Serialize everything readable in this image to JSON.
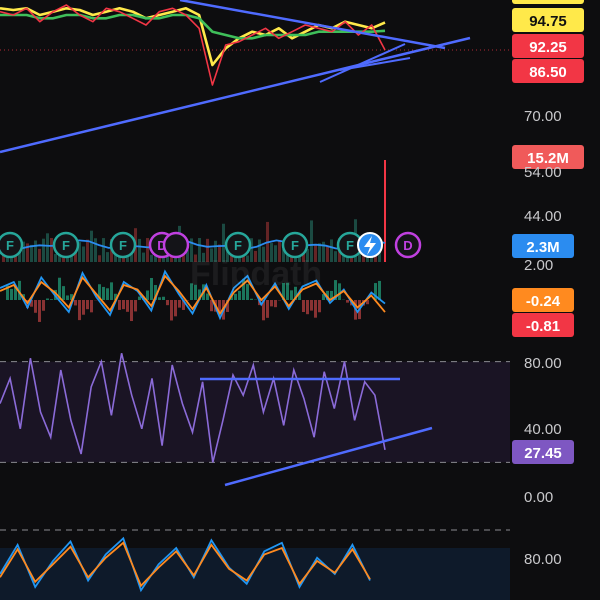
{
  "watermark": "Flipdath",
  "colors": {
    "background": "#0d0d0f",
    "rsi_band": "#1a1424",
    "yellow": "#ffe94a",
    "red": "#f23645",
    "blue_line": "#4f6bff",
    "volume_badge": "#f05a5a",
    "blue_badge": "#2b8cf0",
    "orange_badge": "#ff8a1f",
    "purple_badge": "#7e57c2",
    "macd_blue": "#2196f3",
    "macd_orange": "#ff8a1f",
    "rsi_purple": "#8b6bd8",
    "stoch_fill": "#0e1a2a",
    "event_green": "#26a69a",
    "event_purple": "#c040e0"
  },
  "price_axis": {
    "badges": [
      {
        "label": "94.75",
        "kind": "yellow"
      },
      {
        "label": "92.25",
        "kind": "red"
      },
      {
        "label": "86.50",
        "kind": "red"
      }
    ],
    "ticks": [
      "70.00"
    ]
  },
  "volume_axis": {
    "badge": "15.2M",
    "ticks": [
      "54.00",
      "44.00"
    ]
  },
  "event_markers": {
    "labels": [
      "F",
      "F",
      "F",
      "D",
      "F",
      "F",
      "F",
      "D"
    ],
    "flash_icon": "lightning-icon",
    "badge": "2.3M"
  },
  "macd_axis": {
    "tick": "2.00",
    "badges": [
      "-0.24",
      "-0.81"
    ]
  },
  "rsi_axis": {
    "ticks": [
      "80.00",
      "40.00",
      "0.00"
    ],
    "badge": "27.45"
  },
  "stoch_axis": {
    "ticks": [
      "80.00"
    ]
  },
  "chart_data": [
    {
      "type": "line",
      "panel": "price",
      "series": [
        {
          "color": "yellow",
          "values": [
            99,
            98.5,
            99,
            97,
            98,
            99,
            98.5,
            97,
            98,
            99,
            98,
            96,
            97,
            98,
            99,
            97,
            82,
            87,
            90,
            92,
            91,
            93,
            90,
            92,
            94,
            93,
            95,
            94,
            93,
            94.75
          ]
        },
        {
          "color": "green",
          "values": [
            97,
            97,
            97,
            96,
            96,
            97,
            97,
            96,
            96,
            97,
            97,
            96,
            96,
            97,
            97,
            96,
            92,
            91,
            90,
            90,
            91,
            91,
            91,
            91,
            92,
            92,
            92,
            92,
            92,
            92.25
          ]
        },
        {
          "color": "red",
          "values": [
            98,
            97,
            99,
            95,
            98,
            100,
            97,
            95,
            99,
            98,
            96,
            94,
            98,
            99,
            97,
            93,
            76,
            88,
            89,
            91,
            93,
            90,
            92,
            94,
            93,
            92,
            95,
            91,
            94,
            86.5
          ]
        }
      ],
      "last_value": 86.5
    },
    {
      "type": "bar",
      "panel": "volume",
      "last_value": "15.2M"
    },
    {
      "type": "line",
      "panel": "macd",
      "series": [
        {
          "color": "blue",
          "values": [
            0.8,
            1.2,
            -0.5,
            1.5,
            0.3,
            -0.8,
            1.8,
            0.2,
            -1.0,
            1.2,
            0.6,
            -0.7,
            1.9,
            0.4,
            -0.9,
            1.0,
            -1.2,
            0.8,
            1.6,
            -0.3,
            1.1,
            -0.6,
            0.9,
            1.3,
            -0.2,
            0.7,
            -0.8,
            0.5,
            -0.24
          ]
        },
        {
          "color": "orange",
          "values": [
            0.6,
            1.0,
            -0.2,
            1.2,
            0.5,
            -0.5,
            1.5,
            0.4,
            -0.7,
            1.0,
            0.7,
            -0.4,
            1.6,
            0.6,
            -0.6,
            0.8,
            -0.9,
            0.5,
            1.3,
            0.0,
            0.9,
            -0.4,
            0.7,
            1.1,
            0.0,
            0.6,
            -0.5,
            0.3,
            -0.81
          ]
        }
      ],
      "last_values": [
        -0.24,
        -0.81
      ]
    },
    {
      "type": "line",
      "panel": "rsi",
      "ylim": [
        0,
        100
      ],
      "band": [
        20,
        80
      ],
      "values": [
        55,
        70,
        40,
        82,
        50,
        35,
        75,
        45,
        25,
        65,
        80,
        48,
        85,
        60,
        40,
        70,
        30,
        78,
        55,
        38,
        68,
        20,
        45,
        72,
        60,
        78,
        50,
        70,
        42,
        75,
        58,
        35,
        74,
        52,
        80,
        45,
        68,
        60,
        27.45
      ],
      "last_value": 27.45
    },
    {
      "type": "line",
      "panel": "stochastic",
      "series": [
        {
          "color": "blue",
          "values": [
            40,
            85,
            20,
            60,
            90,
            30,
            70,
            95,
            15,
            55,
            80,
            35,
            92,
            50,
            25,
            75,
            88,
            20,
            65,
            40,
            85,
            30
          ]
        },
        {
          "color": "orange",
          "values": [
            35,
            78,
            28,
            55,
            82,
            35,
            65,
            88,
            22,
            50,
            75,
            38,
            85,
            48,
            30,
            70,
            80,
            25,
            60,
            42,
            78,
            32
          ]
        }
      ]
    }
  ]
}
